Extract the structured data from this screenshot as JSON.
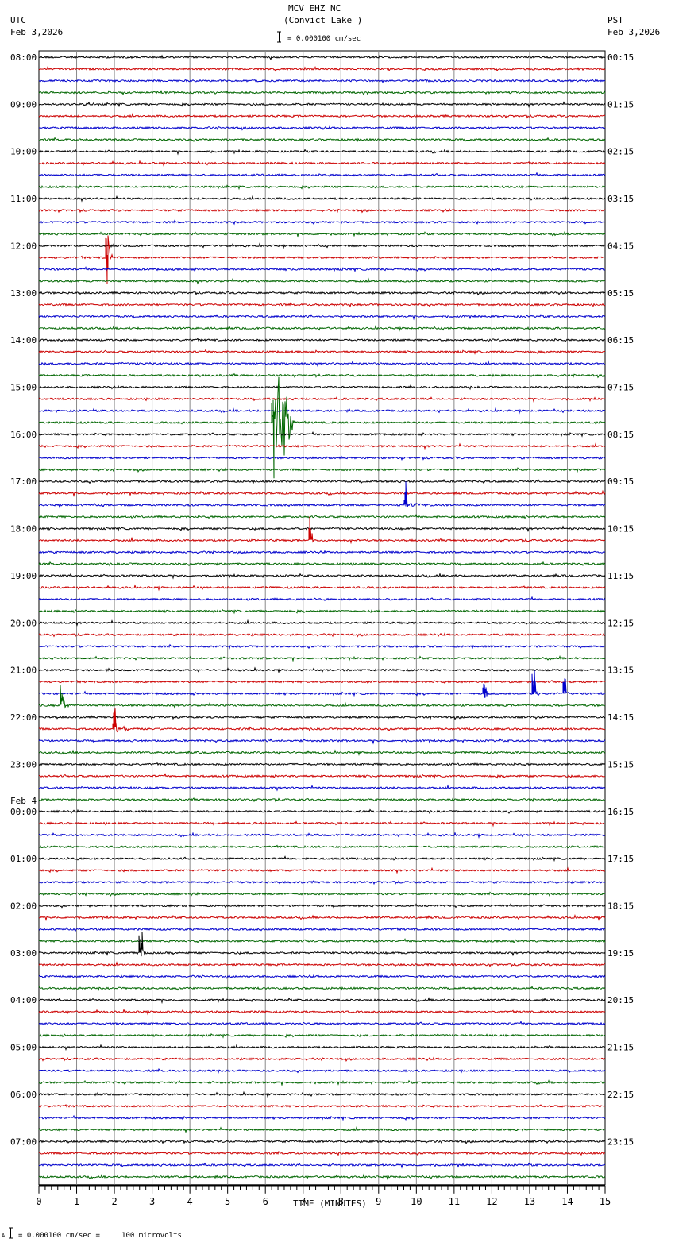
{
  "header": {
    "station": "MCV EHZ NC",
    "location": "(Convict Lake )",
    "left_tz": "UTC",
    "left_date": "Feb 3,2026",
    "right_tz": "PST",
    "right_date": "Feb 3,2026",
    "scale_text": "= 0.000100 cm/sec"
  },
  "footer": {
    "scale_text": "= 0.000100 cm/sec =     100 microvolts",
    "marker": "A"
  },
  "chart_data": {
    "type": "line",
    "title": "MCV EHZ NC (Convict Lake )",
    "xlabel": "TIME (MINUTES)",
    "xlim": [
      0,
      15
    ],
    "x_ticks": [
      "0",
      "1",
      "2",
      "3",
      "4",
      "5",
      "6",
      "7",
      "8",
      "9",
      "10",
      "11",
      "12",
      "13",
      "14",
      "15"
    ],
    "traces_per_hour": 4,
    "trace_colors": [
      "#000000",
      "#cc0000",
      "#0000cc",
      "#006600"
    ],
    "left_labels": [
      "08:00",
      "09:00",
      "10:00",
      "11:00",
      "12:00",
      "13:00",
      "14:00",
      "15:00",
      "16:00",
      "17:00",
      "18:00",
      "19:00",
      "20:00",
      "21:00",
      "22:00",
      "23:00",
      "00:00",
      "01:00",
      "02:00",
      "03:00",
      "04:00",
      "05:00",
      "06:00",
      "07:00"
    ],
    "date_change_label": "Feb 4",
    "date_change_index": 16,
    "right_labels": [
      "00:15",
      "01:15",
      "02:15",
      "03:15",
      "04:15",
      "05:15",
      "06:15",
      "07:15",
      "08:15",
      "09:15",
      "10:15",
      "11:15",
      "12:15",
      "13:15",
      "14:15",
      "15:15",
      "16:15",
      "17:15",
      "18:15",
      "19:15",
      "20:15",
      "21:15",
      "22:15",
      "23:15"
    ],
    "events": [
      {
        "trace": 17,
        "minute": 1.8,
        "amplitude": 40,
        "duration": 0.15
      },
      {
        "trace": 31,
        "minute": 6.2,
        "amplitude": 85,
        "duration": 0.6
      },
      {
        "trace": 38,
        "minute": 9.7,
        "amplitude": 3,
        "duration": 0.8
      },
      {
        "trace": 41,
        "minute": 7.2,
        "amplitude": 3,
        "duration": 0.1
      },
      {
        "trace": 54,
        "minute": 11.8,
        "amplitude": 6,
        "duration": 0.15
      },
      {
        "trace": 54,
        "minute": 13.1,
        "amplitude": 5,
        "duration": 0.2
      },
      {
        "trace": 54,
        "minute": 13.9,
        "amplitude": 4,
        "duration": 0.2
      },
      {
        "trace": 55,
        "minute": 0.6,
        "amplitude": 7,
        "duration": 0.2
      },
      {
        "trace": 57,
        "minute": 2.0,
        "amplitude": 4,
        "duration": 0.8
      },
      {
        "trace": 76,
        "minute": 2.7,
        "amplitude": 13,
        "duration": 0.12
      }
    ]
  }
}
